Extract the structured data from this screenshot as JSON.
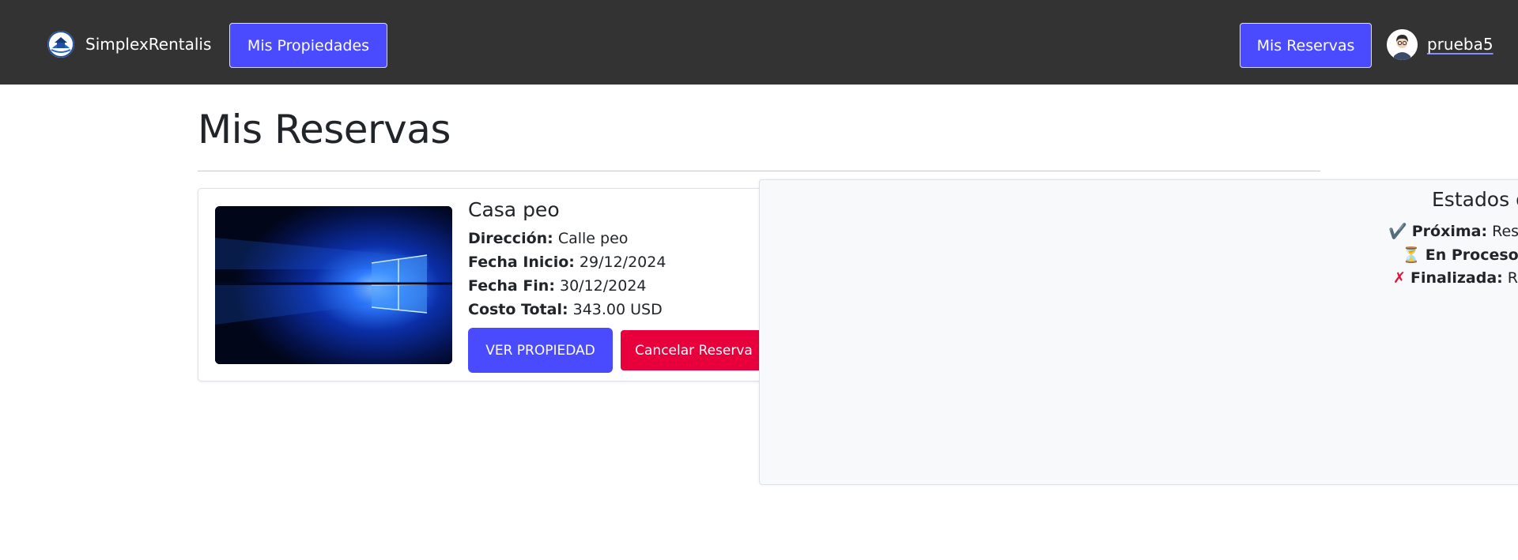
{
  "navbar": {
    "brand": "SimplexRentalis",
    "propiedades_label": "Mis Propiedades",
    "reservas_label": "Mis Reservas",
    "username": "prueba5"
  },
  "page": {
    "title": "Mis Reservas"
  },
  "reserva": {
    "title": "Casa peo",
    "direccion_label": "Dirección:",
    "direccion": "Calle peo",
    "inicio_label": "Fecha Inicio:",
    "inicio": "29/12/2024",
    "fin_label": "Fecha Fin:",
    "fin": "30/12/2024",
    "costo_label": "Costo Total:",
    "costo": "343.00 USD",
    "ver_label": "VER PROPIEDAD",
    "cancelar_label": "Cancelar Reserva"
  },
  "legend": {
    "title": "Estados d",
    "items": [
      {
        "icon": "✔️",
        "label": "Próxima:",
        "text": "Reser"
      },
      {
        "icon": "⏳",
        "label": "En Proceso:",
        "text": "R"
      },
      {
        "icon": "✗",
        "label": "Finalizada:",
        "text": "Res"
      }
    ]
  },
  "colors": {
    "navbar": "#333333",
    "primary": "#4a4aff",
    "danger": "#e8003d",
    "panel": "#f8f9fa"
  }
}
